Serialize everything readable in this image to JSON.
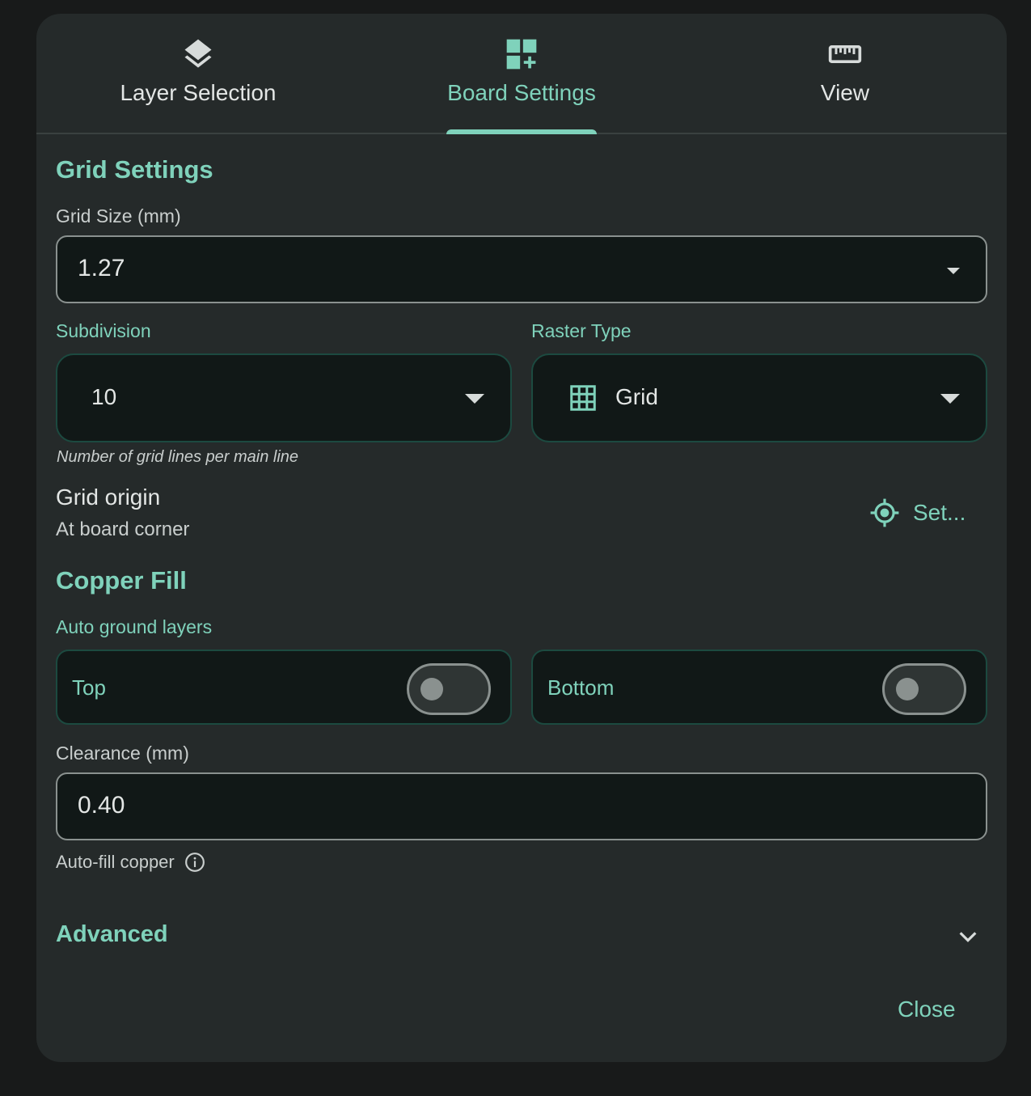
{
  "tabs": [
    {
      "label": "Layer Selection",
      "icon": "layers-icon",
      "active": false
    },
    {
      "label": "Board Settings",
      "icon": "dashboard-add-icon",
      "active": true
    },
    {
      "label": "View",
      "icon": "ruler-icon",
      "active": false
    }
  ],
  "grid_settings": {
    "title": "Grid Settings",
    "grid_size": {
      "label": "Grid Size (mm)",
      "value": "1.27"
    },
    "subdivision": {
      "label": "Subdivision",
      "value": "10",
      "helper": "Number of grid lines per main line"
    },
    "raster_type": {
      "label": "Raster Type",
      "value": "Grid",
      "icon": "grid-icon"
    },
    "origin": {
      "title": "Grid origin",
      "subtitle": "At board corner",
      "button_label": "Set..."
    }
  },
  "copper_fill": {
    "title": "Copper Fill",
    "auto_ground_label": "Auto ground layers",
    "top": {
      "label": "Top",
      "on": false
    },
    "bottom": {
      "label": "Bottom",
      "on": false
    },
    "clearance": {
      "label": "Clearance (mm)",
      "value": "0.40"
    },
    "auto_fill_label": "Auto-fill copper"
  },
  "advanced": {
    "label": "Advanced"
  },
  "actions": {
    "close_label": "Close"
  },
  "colors": {
    "accent": "#7fd2bb",
    "surface": "#252a2a",
    "field_bg": "#111817",
    "background": "#181a1a"
  }
}
